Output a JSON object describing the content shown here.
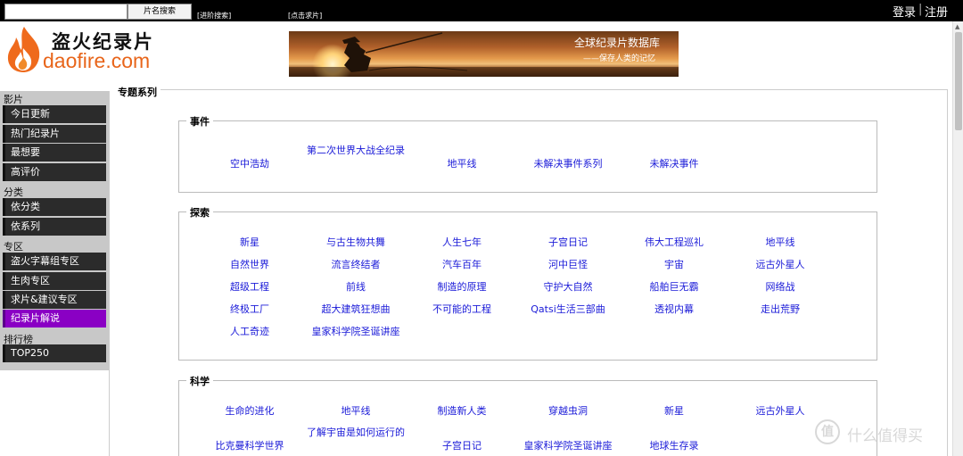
{
  "topbar": {
    "search_button": "片名搜索",
    "advanced_search": "[进阶搜索]",
    "request_link": "[点击求片]",
    "login": "登录",
    "separator": "|",
    "register": "注册"
  },
  "logo": {
    "cn": "盗火纪录片",
    "en": "daofire.com"
  },
  "banner": {
    "title": "全球纪录片数据库",
    "subtitle": "——保存人类的记忆"
  },
  "sidebar": {
    "sections": [
      {
        "label": "影片",
        "items": [
          "今日更新",
          "热门纪录片",
          "最想要",
          "高评价"
        ]
      },
      {
        "label": "分类",
        "items": [
          "依分类",
          "依系列"
        ]
      },
      {
        "label": "专区",
        "items": [
          "盗火字幕组专区",
          "生肉专区",
          "求片&建议专区",
          "纪录片解说"
        ]
      },
      {
        "label": "排行榜",
        "items": [
          "TOP250"
        ]
      }
    ],
    "active_item": "纪录片解说"
  },
  "main": {
    "title": "专题系列",
    "groups": [
      {
        "label": "事件",
        "links": [
          "空中浩劫",
          "第二次世界大战全纪录",
          "地平线",
          "未解决事件系列",
          "未解决事件"
        ]
      },
      {
        "label": "探索",
        "links": [
          "新星",
          "与古生物共舞",
          "人生七年",
          "子宫日记",
          "伟大工程巡礼",
          "地平线",
          "自然世界",
          "流言终结者",
          "汽车百年",
          "河中巨怪",
          "宇宙",
          "远古外星人",
          "超级工程",
          "前线",
          "制造的原理",
          "守护大自然",
          "船舶巨无霸",
          "网络战",
          "终极工厂",
          "超大建筑狂想曲",
          "不可能的工程",
          "Qatsi生活三部曲",
          "透视内幕",
          "走出荒野",
          "人工奇迹",
          "皇家科学院圣诞讲座"
        ]
      },
      {
        "label": "科学",
        "links": [
          "生命的进化",
          "地平线",
          "制造新人类",
          "穿越虫洞",
          "新星",
          "远古外星人",
          "比克曼科学世界",
          "了解宇宙是如何运行的",
          "子宫日记",
          "皇家科学院圣诞讲座",
          "地球生存录"
        ]
      }
    ]
  },
  "watermark": {
    "mark": "值",
    "text": "什么值得买"
  },
  "colors": {
    "link": "#1a1ad8",
    "active_sidebar": "#8a00c4",
    "logo_orange": "#e8651a"
  }
}
